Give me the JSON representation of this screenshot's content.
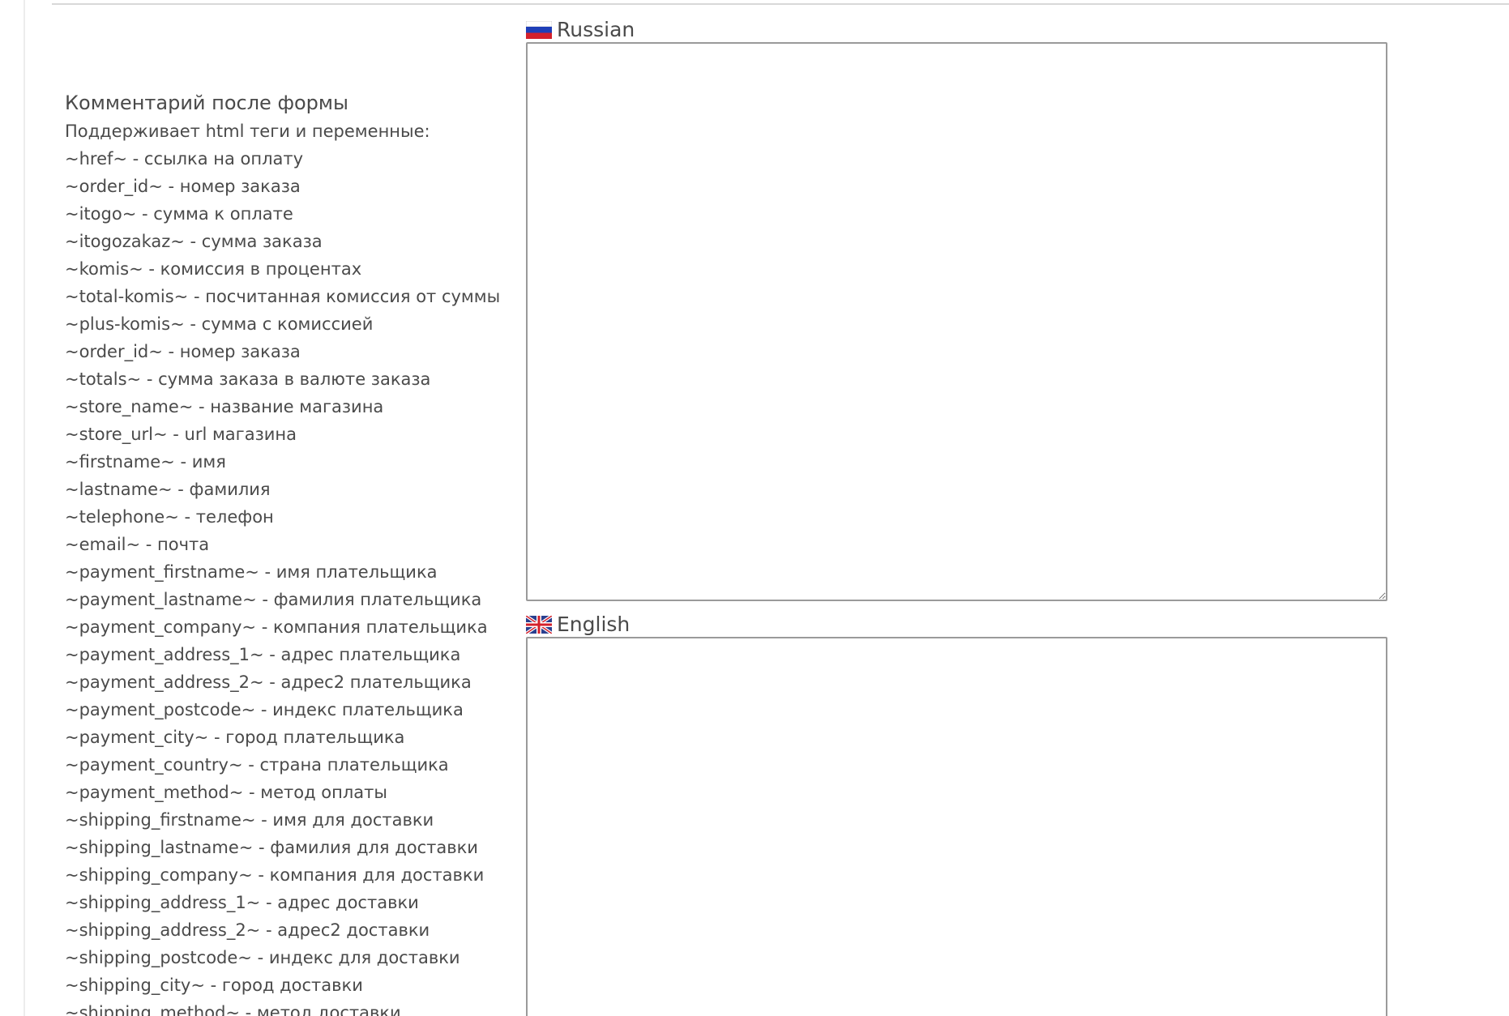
{
  "field": {
    "title": "Комментарий после формы",
    "help_lines": [
      "Поддерживает html теги и переменные:",
      "~href~ - ссылка на оплату",
      "~order_id~ - номер заказа",
      "~itogo~ - сумма к оплате",
      "~itogozakaz~ - сумма заказа",
      "~komis~ - комиссия в процентах",
      "~total-komis~ - посчитанная комиссия от суммы",
      "~plus-komis~ - сумма с комиссией",
      "~order_id~ - номер заказа",
      "~totals~ - сумма заказа в валюте заказа",
      "~store_name~ - название магазина",
      "~store_url~ - url магазина",
      "~firstname~ - имя",
      "~lastname~ - фамилия",
      "~telephone~ - телефон",
      "~email~ - почта",
      "~payment_firstname~ - имя плательщика",
      "~payment_lastname~ - фамилия плательщика",
      "~payment_company~ - компания плательщика",
      "~payment_address_1~ - адрес плательщика",
      "~payment_address_2~ - адрес2 плательщика",
      "~payment_postcode~ - индекс плательщика",
      "~payment_city~ - город плательщика",
      "~payment_country~ - страна плательщика",
      "~payment_method~ - метод оплаты",
      "~shipping_firstname~ - имя для доставки",
      "~shipping_lastname~ - фамилия для доставки",
      "~shipping_company~ - компания для доставки",
      "~shipping_address_1~ - адрес доставки",
      "~shipping_address_2~ - адрес2 доставки",
      "~shipping_postcode~ - индекс для доставки",
      "~shipping_city~ - город доставки",
      "~shipping_method~ - метод доставки"
    ]
  },
  "languages": [
    {
      "name": "Russian",
      "flag": "russia-flag-icon",
      "value": ""
    },
    {
      "name": "English",
      "flag": "uk-flag-icon",
      "value": ""
    }
  ],
  "colors": {
    "text": "#4a4a4a",
    "border": "#9a9a9a",
    "divider": "#d8d8d8"
  }
}
